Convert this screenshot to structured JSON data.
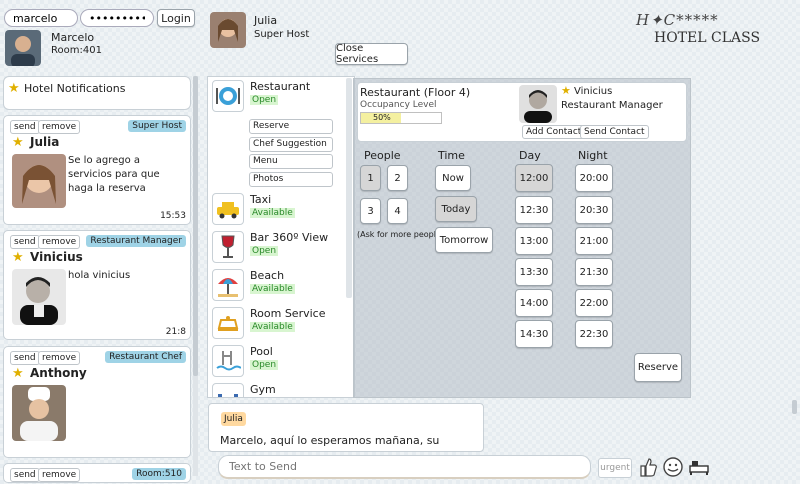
{
  "login": {
    "username": "marcelo",
    "password": "••••••••••••",
    "button": "Login"
  },
  "current_user": {
    "name": "Marcelo",
    "room": "Room:401"
  },
  "contact": {
    "name": "Julia",
    "role": "Super Host",
    "close_button": "Close Services"
  },
  "brand": {
    "monogram": "H✦C*****",
    "name": "HOTEL CLASS"
  },
  "notifications": {
    "title": "Hotel Notifications"
  },
  "cards": [
    {
      "send": "send",
      "remove": "remove",
      "badge": "Super Host",
      "name": "Julia",
      "message": "Se lo agrego a servicios para que haga la reserva",
      "time": "15:53"
    },
    {
      "send": "send",
      "remove": "remove",
      "badge": "Restaurant Manager",
      "name": "Vinicius",
      "message": "hola vinicius",
      "time": "21:8"
    },
    {
      "send": "send",
      "remove": "remove",
      "badge": "Restaurant Chef",
      "name": "Anthony"
    },
    {
      "send": "send",
      "remove": "remove",
      "badge": "Room:510"
    }
  ],
  "services": [
    {
      "name": "Restaurant",
      "status": "Open"
    },
    {
      "name": "Taxi",
      "status": "Available"
    },
    {
      "name": "Bar 360º View",
      "status": "Open"
    },
    {
      "name": "Beach",
      "status": "Available"
    },
    {
      "name": "Room Service",
      "status": "Available"
    },
    {
      "name": "Pool",
      "status": "Open"
    },
    {
      "name": "Gym"
    }
  ],
  "restaurant_options": [
    "Reserve",
    "Chef Suggestion",
    "Menu",
    "Photos"
  ],
  "detail": {
    "title": "Restaurant (Floor 4)",
    "occupancy_label": "Occupancy Level",
    "occupancy_percent": 50,
    "occupancy_text": "50%",
    "manager_name": "Vinicius",
    "manager_role": "Restaurant Manager",
    "add_contact": "Add Contact",
    "send_contact": "Send Contact",
    "people_label": "People",
    "people": [
      "1",
      "2",
      "3",
      "4"
    ],
    "people_note": "(Ask for more people)",
    "time_label": "Time",
    "times": [
      "Now",
      "Today",
      "Tomorrow"
    ],
    "day_label": "Day",
    "day_slots": [
      "12:00",
      "12:30",
      "13:00",
      "13:30",
      "14:00",
      "14:30"
    ],
    "night_label": "Night",
    "night_slots": [
      "20:00",
      "20:30",
      "21:00",
      "21:30",
      "22:00",
      "22:30"
    ],
    "reserve_button": "Reserve"
  },
  "chat": {
    "sender": "Julia",
    "message": "Marcelo, aquí lo esperamos mañana, su",
    "input_placeholder": "Text to Send",
    "urgent": "urgent"
  },
  "colors": {
    "badge": "#9fd3e6",
    "status_green": "#2a8a2a",
    "occupancy_fill": "#f4f0a0",
    "sender_tag": "#ffd9a0"
  }
}
